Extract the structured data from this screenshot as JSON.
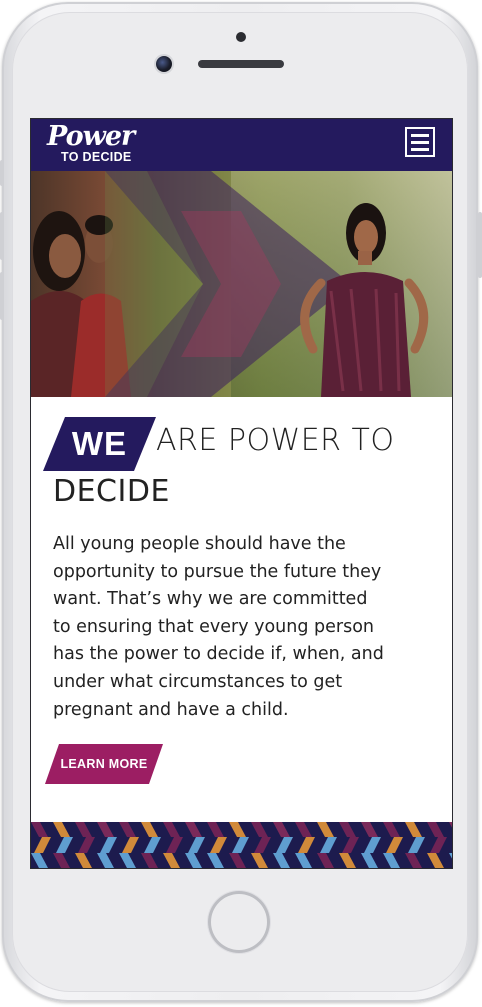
{
  "header": {
    "logo_line1": "Power",
    "logo_line2": "TO DECIDE",
    "menu_icon": "hamburger-icon"
  },
  "hero": {
    "description_icon": "chevron-arrow-graphic"
  },
  "headline": {
    "badge": "WE",
    "rest_line1": "ARE POWER TO",
    "line2": "DECIDE"
  },
  "body": {
    "lines": [
      "All young people should have the",
      "opportunity to pursue the future they",
      "want. That’s why we are committed",
      "to ensuring that every young person",
      "has the power to decide if, when, and",
      "under what circumstances to get",
      "pregnant and have a child."
    ]
  },
  "cta": {
    "learn_more": "LEARN MORE"
  },
  "colors": {
    "brand_navy": "#241a5e",
    "brand_magenta": "#9c1e63",
    "pattern_orange": "#d18a3a",
    "pattern_blue": "#5f9ed0",
    "pattern_plum": "#6e2355"
  }
}
